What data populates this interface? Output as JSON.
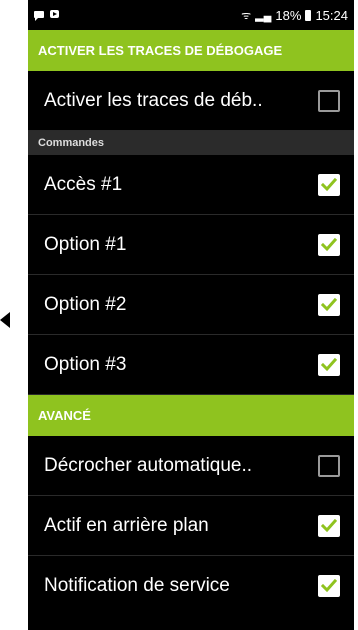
{
  "status": {
    "right_text": "18%",
    "time": "15:24"
  },
  "header_debug": "ACTIVER LES TRACES DE DÉBOGAGE",
  "row_debug": {
    "label": "Activer les traces de déb..",
    "checked": false
  },
  "section_commands": "Commandes",
  "commands": [
    {
      "label": "Accès #1",
      "checked": true
    },
    {
      "label": "Option #1",
      "checked": true
    },
    {
      "label": "Option #2",
      "checked": true
    },
    {
      "label": "Option #3",
      "checked": true
    }
  ],
  "header_advanced": "AVANCÉ",
  "advanced": [
    {
      "label": "Décrocher automatique..",
      "checked": false
    },
    {
      "label": "Actif en arrière plan",
      "checked": true
    },
    {
      "label": "Notification de service",
      "checked": true
    }
  ],
  "colors": {
    "accent": "#8fc31f",
    "check": "#8fc31f"
  }
}
